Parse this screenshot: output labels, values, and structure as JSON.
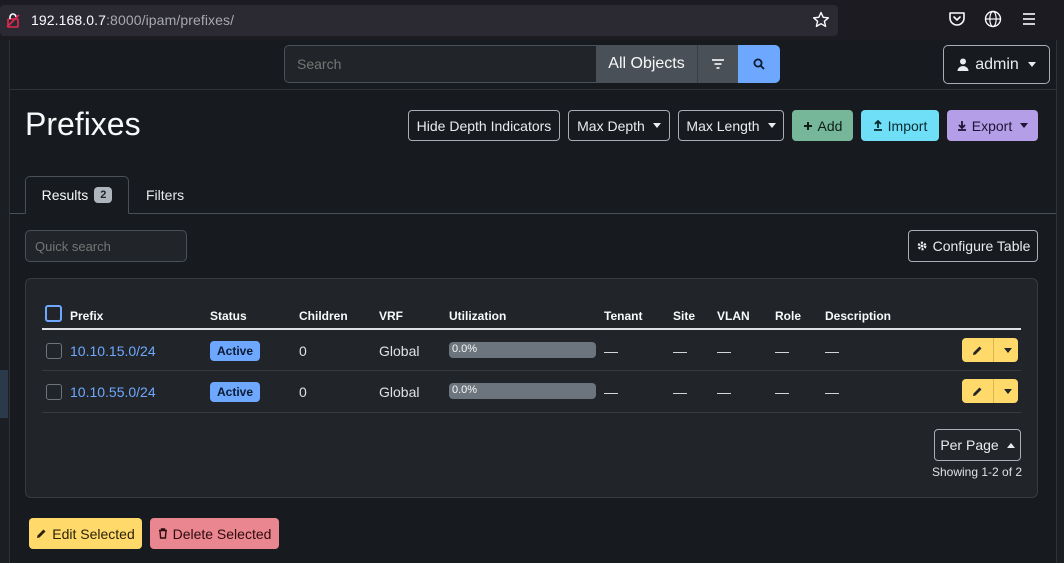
{
  "browser": {
    "url_host": "192.168.0.7",
    "url_path": ":8000/ipam/prefixes/"
  },
  "topnav": {
    "search_placeholder": "Search",
    "search_scope": "All Objects",
    "user_label": "admin"
  },
  "page": {
    "title": "Prefixes"
  },
  "toolbar": {
    "hide_depth": "Hide Depth Indicators",
    "max_depth": "Max Depth",
    "max_length": "Max Length",
    "add": "Add",
    "import": "Import",
    "export": "Export"
  },
  "tabs": {
    "results_label": "Results",
    "results_count": "2",
    "filters_label": "Filters"
  },
  "quick_search_placeholder": "Quick search",
  "configure_table": "Configure Table",
  "table": {
    "headers": [
      "Prefix",
      "Status",
      "Children",
      "VRF",
      "Utilization",
      "Tenant",
      "Site",
      "VLAN",
      "Role",
      "Description"
    ],
    "rows": [
      {
        "prefix": "10.10.15.0/24",
        "status": "Active",
        "children": "0",
        "vrf": "Global",
        "utilization": "0.0%",
        "utilization_value": 0.0,
        "tenant": "—",
        "site": "—",
        "vlan": "—",
        "role": "—",
        "description": "—"
      },
      {
        "prefix": "10.10.55.0/24",
        "status": "Active",
        "children": "0",
        "vrf": "Global",
        "utilization": "0.0%",
        "utilization_value": 0.0,
        "tenant": "—",
        "site": "—",
        "vlan": "—",
        "role": "—",
        "description": "—"
      }
    ]
  },
  "pagination": {
    "per_page": "Per Page",
    "showing": "Showing 1-2 of 2"
  },
  "bulk": {
    "edit_selected": "Edit Selected",
    "delete_selected": "Delete Selected"
  },
  "colors": {
    "accent": "#6ea8fe",
    "warning": "#ffda6a",
    "danger": "#ea868f",
    "success": "#75b798",
    "info": "#6edff6",
    "purple": "#b59ee8"
  }
}
